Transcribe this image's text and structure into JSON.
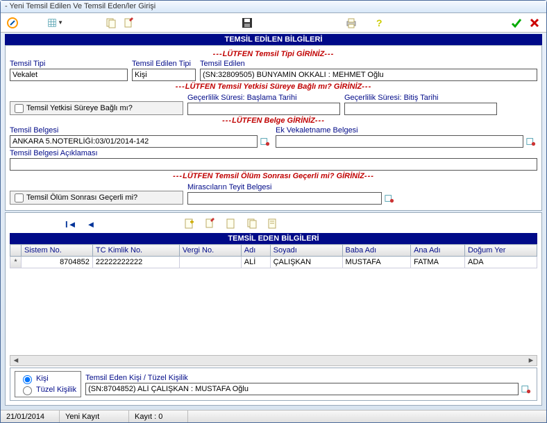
{
  "window": {
    "title": "- Yeni Temsil Edilen Ve Temsil Eden/ler Girişi"
  },
  "section1": {
    "header": "TEMSİL EDİLEN BİLGİLERİ"
  },
  "section2": {
    "header": "TEMSİL EDEN BİLGİLERİ"
  },
  "legends": {
    "type": "LÜTFEN Temsil Tipi GİRİNİZ",
    "duration": "LÜTFEN Temsil Yetkisi Süreye Bağlı mı? GİRİNİZ",
    "doc": "LÜTFEN Belge GİRİNİZ",
    "death": "LÜTFEN Temsil Ölüm Sonrası Geçerli mi? GİRİNİZ"
  },
  "labels": {
    "tip": "Temsil Tipi",
    "edilenTip": "Temsil Edilen Tipi",
    "edilen": "Temsil Edilen",
    "sureBagli": "Temsil Yetkisi Süreye Bağlı mı?",
    "baslama": "Geçerlilik Süresi: Başlama Tarihi",
    "bitis": "Geçerlilik Süresi: Bitiş Tarihi",
    "belge": "Temsil Belgesi",
    "ekVek": "Ek Vekaletname Belgesi",
    "aciklama": "Temsil Belgesi Açıklaması",
    "olumGecerli": "Temsil Ölüm Sonrası Geçerli mi?",
    "miras": "Mirascıların Teyit Belgesi",
    "edenKisi": "Temsil Eden Kişi / Tüzel Kişilik",
    "kisi": "Kişi",
    "tuzel": "Tüzel Kişilik"
  },
  "values": {
    "tip": "Vekalet",
    "edilenTip": "Kişi",
    "edilen": "(SN:32809505) BÜNYAMİN OKKALI : MEHMET Oğlu",
    "belge": "ANKARA 5.NOTERLİĞİ:03/01/2014-142",
    "edenKisi": "(SN:8704852) ALİ ÇALIŞKAN : MUSTAFA Oğlu"
  },
  "grid": {
    "columns": [
      "Sistem No.",
      "TC Kimlik No.",
      "Vergi No.",
      "Adı",
      "Soyadı",
      "Baba Adı",
      "Ana Adı",
      "Doğum Yer"
    ],
    "rowmark": "*",
    "rows": [
      {
        "sistem": "8704852",
        "tc": "22222222222",
        "vergi": "",
        "adi": "ALİ",
        "soyadi": "ÇALIŞKAN",
        "baba": "MUSTAFA",
        "ana": "FATMA",
        "dogum": "ADA"
      }
    ]
  },
  "status": {
    "date": "21/01/2014",
    "state": "Yeni Kayıt",
    "count": "Kayıt : 0"
  }
}
